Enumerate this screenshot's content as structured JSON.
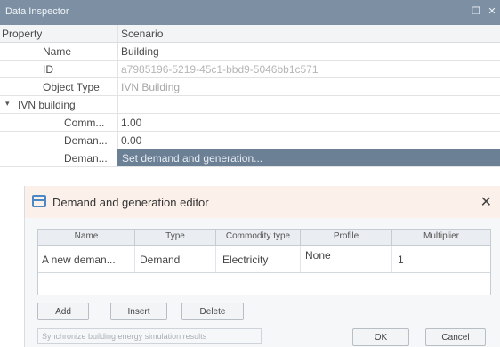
{
  "inspector": {
    "title": "Data Inspector",
    "header": {
      "property": "Property",
      "scenario": "Scenario"
    },
    "rows": [
      {
        "label": "Name",
        "value": "Building"
      },
      {
        "label": "ID",
        "value": "a7985196-5219-45c1-bbd9-5046bb1c571"
      },
      {
        "label": "Object Type",
        "value": "IVN Building"
      },
      {
        "label": "IVN building",
        "value": "",
        "expander": "▾"
      },
      {
        "label": "Comm...",
        "value": "1.00"
      },
      {
        "label": "Deman...",
        "value": "0.00"
      },
      {
        "label": "Deman...",
        "value": "Set demand and generation..."
      }
    ],
    "window_icons": {
      "restore": "restore-window-icon",
      "close": "close-icon"
    }
  },
  "editor": {
    "title": "Demand and generation editor",
    "close_glyph": "✕",
    "columns": [
      "Name",
      "Type",
      "Commodity type",
      "Profile",
      "Multiplier"
    ],
    "rows": [
      {
        "name": "A new deman...",
        "type": "Demand",
        "commodity": "Electricity",
        "profile": "None",
        "multiplier": "1"
      }
    ],
    "buttons": {
      "add": "Add",
      "insert": "Insert",
      "delete": "Delete",
      "ok": "OK",
      "cancel": "Cancel"
    },
    "sync_label": "Synchronize building energy simulation results"
  },
  "colors": {
    "titlebar": "#7d8fa3",
    "selected_cell": "#6b7f95",
    "editor_header": "#fbf1ea",
    "editor_icon": "#4c89c4"
  }
}
